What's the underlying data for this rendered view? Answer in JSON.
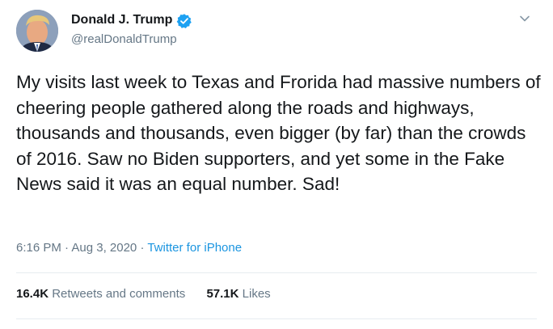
{
  "tweet": {
    "author": {
      "name": "Donald J. Trump",
      "handle": "@realDonaldTrump",
      "avatar_icon": "user-avatar",
      "verified_icon": "verified-badge-icon"
    },
    "text": "My visits last week to Texas and Frorida had massive numbers of cheering people gathered along the roads and highways, thousands and thousands, even bigger (by far) than the crowds of 2016. Saw no Biden supporters, and yet some in the Fake News said it was an equal number. Sad!",
    "timestamp": "6:16 PM · Aug 3, 2020",
    "separator": " · ",
    "source": "Twitter for iPhone",
    "stats": {
      "retweets_count": "16.4K",
      "retweets_label": "Retweets and comments",
      "likes_count": "57.1K",
      "likes_label": "Likes"
    }
  },
  "colors": {
    "primary_text": "#14171a",
    "secondary_text": "#657786",
    "link": "#1b95e0",
    "verified": "#1da1f2",
    "divider": "#e6ecf0"
  }
}
